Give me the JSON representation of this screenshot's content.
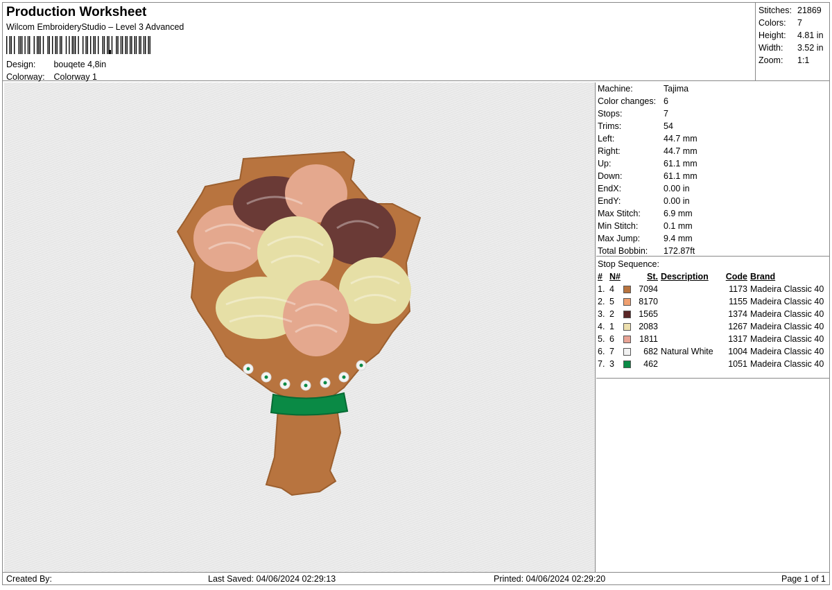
{
  "header": {
    "title": "Production Worksheet",
    "subtitle": "Wilcom EmbroideryStudio – Level 3 Advanced",
    "barcode_label": "barcode",
    "design_label": "Design:",
    "design_value": "bouqete 4,8in",
    "colorway_label": "Colorway:",
    "colorway_value": "Colorway 1"
  },
  "stats": [
    {
      "label": "Stitches:",
      "value": "21869"
    },
    {
      "label": "Colors:",
      "value": "7"
    },
    {
      "label": "Height:",
      "value": "4.81 in"
    },
    {
      "label": "Width:",
      "value": "3.52 in"
    },
    {
      "label": "Zoom:",
      "value": "1:1"
    }
  ],
  "machine": [
    {
      "label": "Machine:",
      "value": "Tajima"
    },
    {
      "label": "Color changes:",
      "value": "6"
    },
    {
      "label": "Stops:",
      "value": "7"
    },
    {
      "label": "Trims:",
      "value": "54"
    },
    {
      "label": "Left:",
      "value": "44.7 mm"
    },
    {
      "label": "Right:",
      "value": "44.7 mm"
    },
    {
      "label": "Up:",
      "value": "61.1 mm"
    },
    {
      "label": "Down:",
      "value": "61.1 mm"
    },
    {
      "label": "EndX:",
      "value": "0.00 in"
    },
    {
      "label": "EndY:",
      "value": "0.00 in"
    },
    {
      "label": "Max Stitch:",
      "value": "6.9 mm"
    },
    {
      "label": "Min Stitch:",
      "value": "0.1 mm"
    },
    {
      "label": "Max Jump:",
      "value": "9.4 mm"
    },
    {
      "label": "Total Bobbin:",
      "value": "172.87ft"
    }
  ],
  "stop_sequence": {
    "caption": "Stop Sequence:",
    "headers": [
      "#",
      "N#",
      "St.",
      "Description",
      "Code",
      "Brand"
    ],
    "rows": [
      {
        "num": "1.",
        "n": "4",
        "color": "#b8743f",
        "st": "7094",
        "desc": "",
        "code": "1173",
        "brand": "Madeira Classic 40"
      },
      {
        "num": "2.",
        "n": "5",
        "color": "#f0a070",
        "st": "8170",
        "desc": "",
        "code": "1155",
        "brand": "Madeira Classic 40"
      },
      {
        "num": "3.",
        "n": "2",
        "color": "#5a2626",
        "st": "1565",
        "desc": "",
        "code": "1374",
        "brand": "Madeira Classic 40"
      },
      {
        "num": "4.",
        "n": "1",
        "color": "#ecdfae",
        "st": "2083",
        "desc": "",
        "code": "1267",
        "brand": "Madeira Classic 40"
      },
      {
        "num": "5.",
        "n": "6",
        "color": "#e8a496",
        "st": "1811",
        "desc": "",
        "code": "1317",
        "brand": "Madeira Classic 40"
      },
      {
        "num": "6.",
        "n": "7",
        "color": "#f2f2f2",
        "st": "682",
        "desc": "Natural White",
        "code": "1004",
        "brand": "Madeira Classic 40"
      },
      {
        "num": "7.",
        "n": "3",
        "color": "#0a8a45",
        "st": "462",
        "desc": "",
        "code": "1051",
        "brand": "Madeira Classic 40"
      }
    ]
  },
  "footer": {
    "created_by": "Created By:",
    "last_saved": "Last Saved: 04/06/2024 02:29:13",
    "printed": "Printed: 04/06/2024 02:29:20",
    "page": "Page 1 of 1"
  },
  "colors": {
    "wrap": "#b8743f",
    "wrap_dark": "#a0622f",
    "cream": "#e6dfa6",
    "pink": "#e4a88e",
    "brown": "#6a3a36",
    "green": "#0a8a45"
  }
}
